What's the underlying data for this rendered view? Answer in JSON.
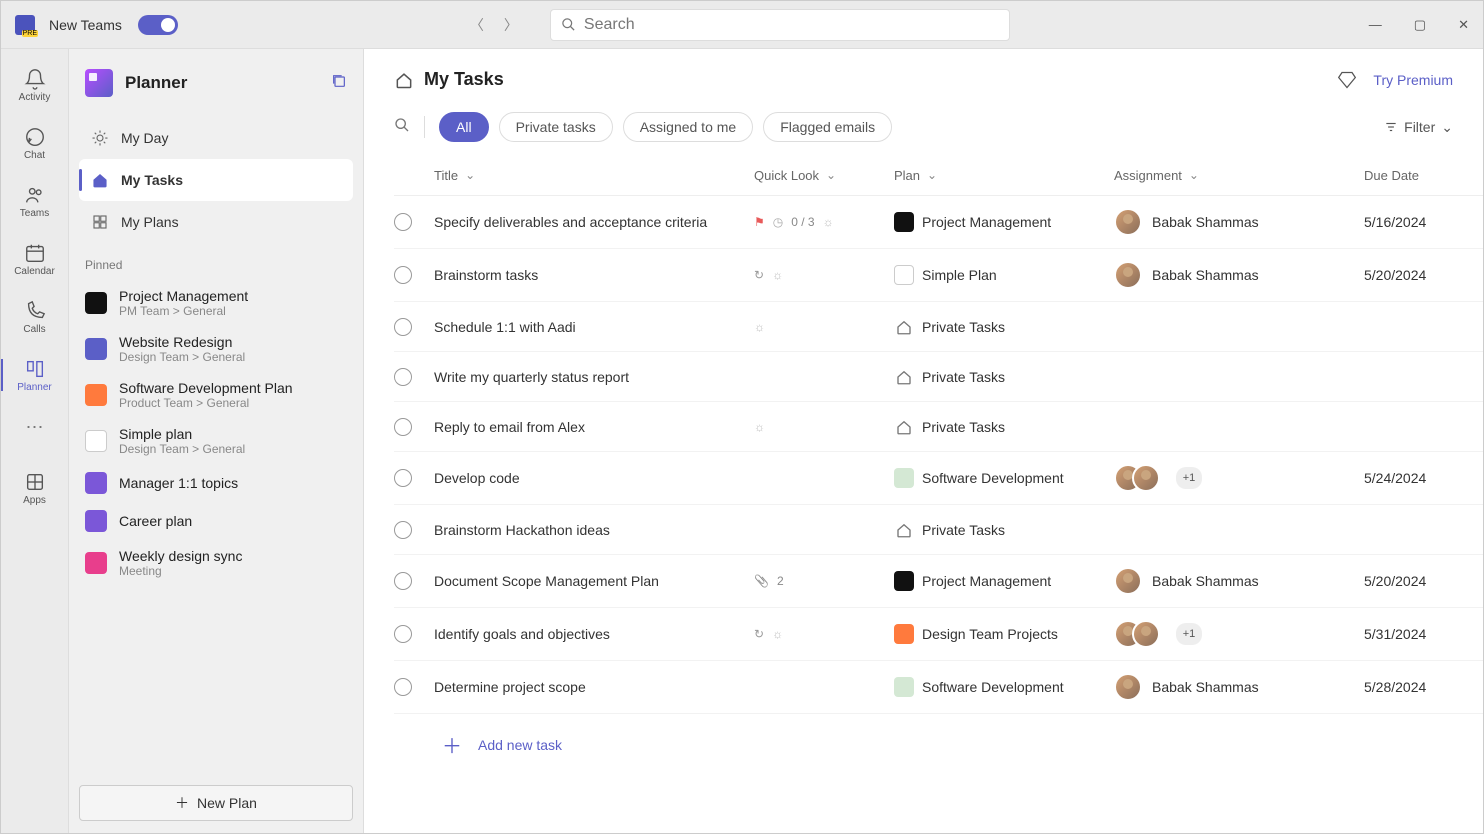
{
  "titlebar": {
    "appName": "New Teams",
    "searchPlaceholder": "Search"
  },
  "rail": {
    "items": [
      {
        "label": "Activity"
      },
      {
        "label": "Chat"
      },
      {
        "label": "Teams"
      },
      {
        "label": "Calendar"
      },
      {
        "label": "Calls"
      },
      {
        "label": "Planner"
      }
    ],
    "apps": "Apps"
  },
  "sidebar": {
    "title": "Planner",
    "nav": {
      "myDay": "My Day",
      "myTasks": "My Tasks",
      "myPlans": "My Plans"
    },
    "pinnedLabel": "Pinned",
    "pinned": [
      {
        "name": "Project Management",
        "sub": "PM Team > General",
        "color": "#111"
      },
      {
        "name": "Website Redesign",
        "sub": "Design Team > General",
        "color": "#5b5fc7"
      },
      {
        "name": "Software Development Plan",
        "sub": "Product Team > General",
        "color": "#ff7a3d"
      },
      {
        "name": "Simple plan",
        "sub": "Design Team > General",
        "color": "#fff",
        "border": "1"
      },
      {
        "name": "Manager 1:1 topics",
        "sub": "",
        "color": "#7b57d8"
      },
      {
        "name": "Career plan",
        "sub": "",
        "color": "#7b57d8"
      },
      {
        "name": "Weekly design sync",
        "sub": "Meeting",
        "color": "#e83e8c"
      }
    ],
    "newPlan": "New Plan"
  },
  "content": {
    "title": "My Tasks",
    "tryPremium": "Try Premium",
    "tabs": {
      "all": "All",
      "private": "Private tasks",
      "assigned": "Assigned to me",
      "flagged": "Flagged emails"
    },
    "filterLabel": "Filter",
    "columns": {
      "title": "Title",
      "quickLook": "Quick Look",
      "plan": "Plan",
      "assignment": "Assignment",
      "dueDate": "Due Date"
    },
    "addTask": "Add new task",
    "tasks": [
      {
        "title": "Specify deliverables and acceptance criteria",
        "flag": true,
        "progress": "0 / 3",
        "sun": true,
        "plan": "Project Management",
        "planColor": "#111",
        "assignee": "Babak Shammas",
        "due": "5/16/2024"
      },
      {
        "title": "Brainstorm tasks",
        "recur": true,
        "sun": true,
        "plan": "Simple Plan",
        "planColor": "#fff",
        "planBorder": "1",
        "assignee": "Babak Shammas",
        "due": "5/20/2024"
      },
      {
        "title": "Schedule 1:1 with Aadi",
        "sun": true,
        "plan": "Private Tasks",
        "private": true
      },
      {
        "title": "Write my quarterly status report",
        "plan": "Private Tasks",
        "private": true
      },
      {
        "title": "Reply to email from Alex",
        "sun": true,
        "plan": "Private Tasks",
        "private": true
      },
      {
        "title": "Develop code",
        "plan": "Software Development",
        "planColor": "#d4e8d4",
        "multi": true,
        "more": "+1",
        "due": "5/24/2024"
      },
      {
        "title": "Brainstorm Hackathon ideas",
        "plan": "Private Tasks",
        "private": true
      },
      {
        "title": "Document Scope Management Plan",
        "attach": "2",
        "plan": "Project Management",
        "planColor": "#111",
        "assignee": "Babak Shammas",
        "due": "5/20/2024"
      },
      {
        "title": "Identify goals and objectives",
        "recur": true,
        "sun": true,
        "plan": "Design Team Projects",
        "planColor": "#ff7a3d",
        "multi": true,
        "more": "+1",
        "due": "5/31/2024"
      },
      {
        "title": "Determine project scope",
        "plan": "Software Development",
        "planColor": "#d4e8d4",
        "assignee": "Babak Shammas",
        "due": "5/28/2024"
      }
    ]
  }
}
